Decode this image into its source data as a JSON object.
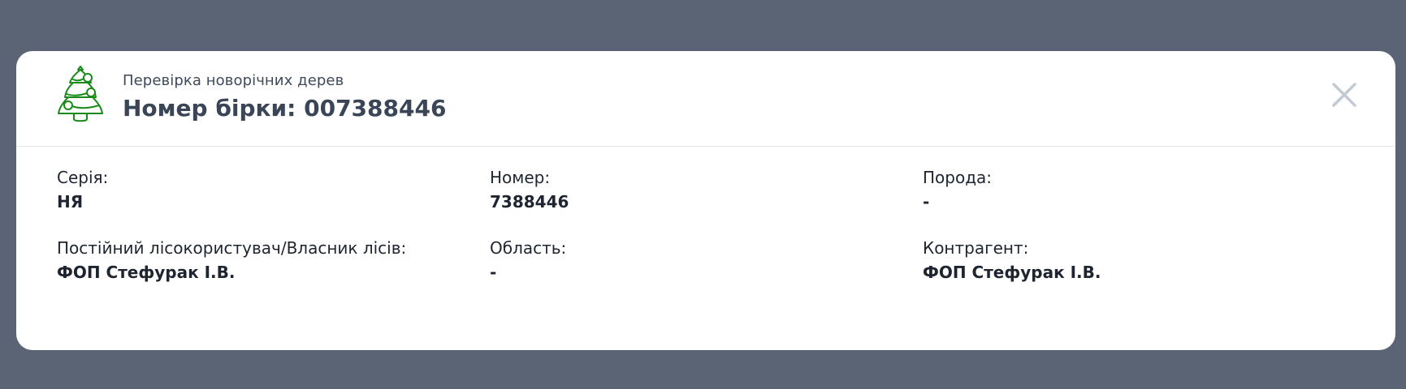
{
  "header": {
    "subtitle": "Перевірка новорічних дерев",
    "title": "Номер бірки: 007388446",
    "icon": "christmas-tree-icon",
    "icon_color": "#1a8a1a"
  },
  "close": {
    "icon": "close-icon",
    "color": "#c4cad4"
  },
  "fields": {
    "series": {
      "label": "Серія:",
      "value": "НЯ"
    },
    "number": {
      "label": "Номер:",
      "value": "7388446"
    },
    "breed": {
      "label": "Порода:",
      "value": "-"
    },
    "owner": {
      "label": "Постійний лісокористувач/Власник лісів:",
      "value": "ФОП Стефурак І.В."
    },
    "region": {
      "label": "Область:",
      "value": "-"
    },
    "counterparty": {
      "label": "Контрагент:",
      "value": "ФОП Стефурак І.В."
    }
  },
  "colors": {
    "backdrop": "#5b6475",
    "panel": "#ffffff",
    "title_text": "#3a4658"
  }
}
